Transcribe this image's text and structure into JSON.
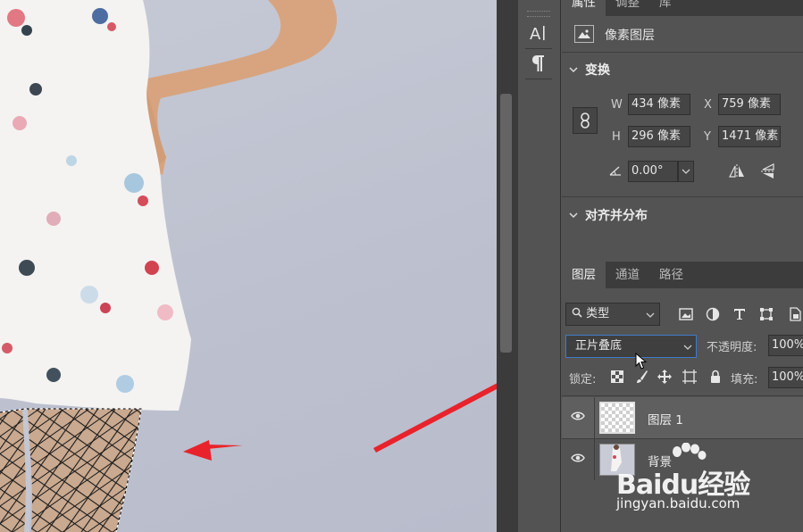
{
  "properties_panel": {
    "tabs": [
      "属性",
      "调整",
      "库"
    ],
    "layer_kind": "像素图层",
    "transform": {
      "title": "变换",
      "w_label": "W",
      "w_value": "434 像素",
      "h_label": "H",
      "h_value": "296 像素",
      "x_label": "X",
      "x_value": "759 像素",
      "y_label": "Y",
      "y_value": "1471 像素",
      "angle_value": "0.00°"
    },
    "align_title": "对齐并分布"
  },
  "layers_panel": {
    "tabs": [
      "图层",
      "通道",
      "路径"
    ],
    "filter_kind": "类型",
    "blend_mode": "正片叠底",
    "opacity_label": "不透明度:",
    "opacity_value": "100%",
    "lock_label": "锁定:",
    "fill_label": "填充:",
    "fill_value": "100%",
    "layers": [
      {
        "name": "图层 1"
      },
      {
        "name": "背景"
      }
    ]
  },
  "tool_column": {
    "icons": [
      "character-icon",
      "paragraph-icon"
    ]
  },
  "watermark": {
    "brand": "Baidu经验",
    "site": "jingyan.baidu.com"
  },
  "colors": {
    "panel_bg": "#535353",
    "tab_bar": "#3c3c3c",
    "selected_layer": "#5f5f5f",
    "annotation_arrow": "#e8232b"
  }
}
